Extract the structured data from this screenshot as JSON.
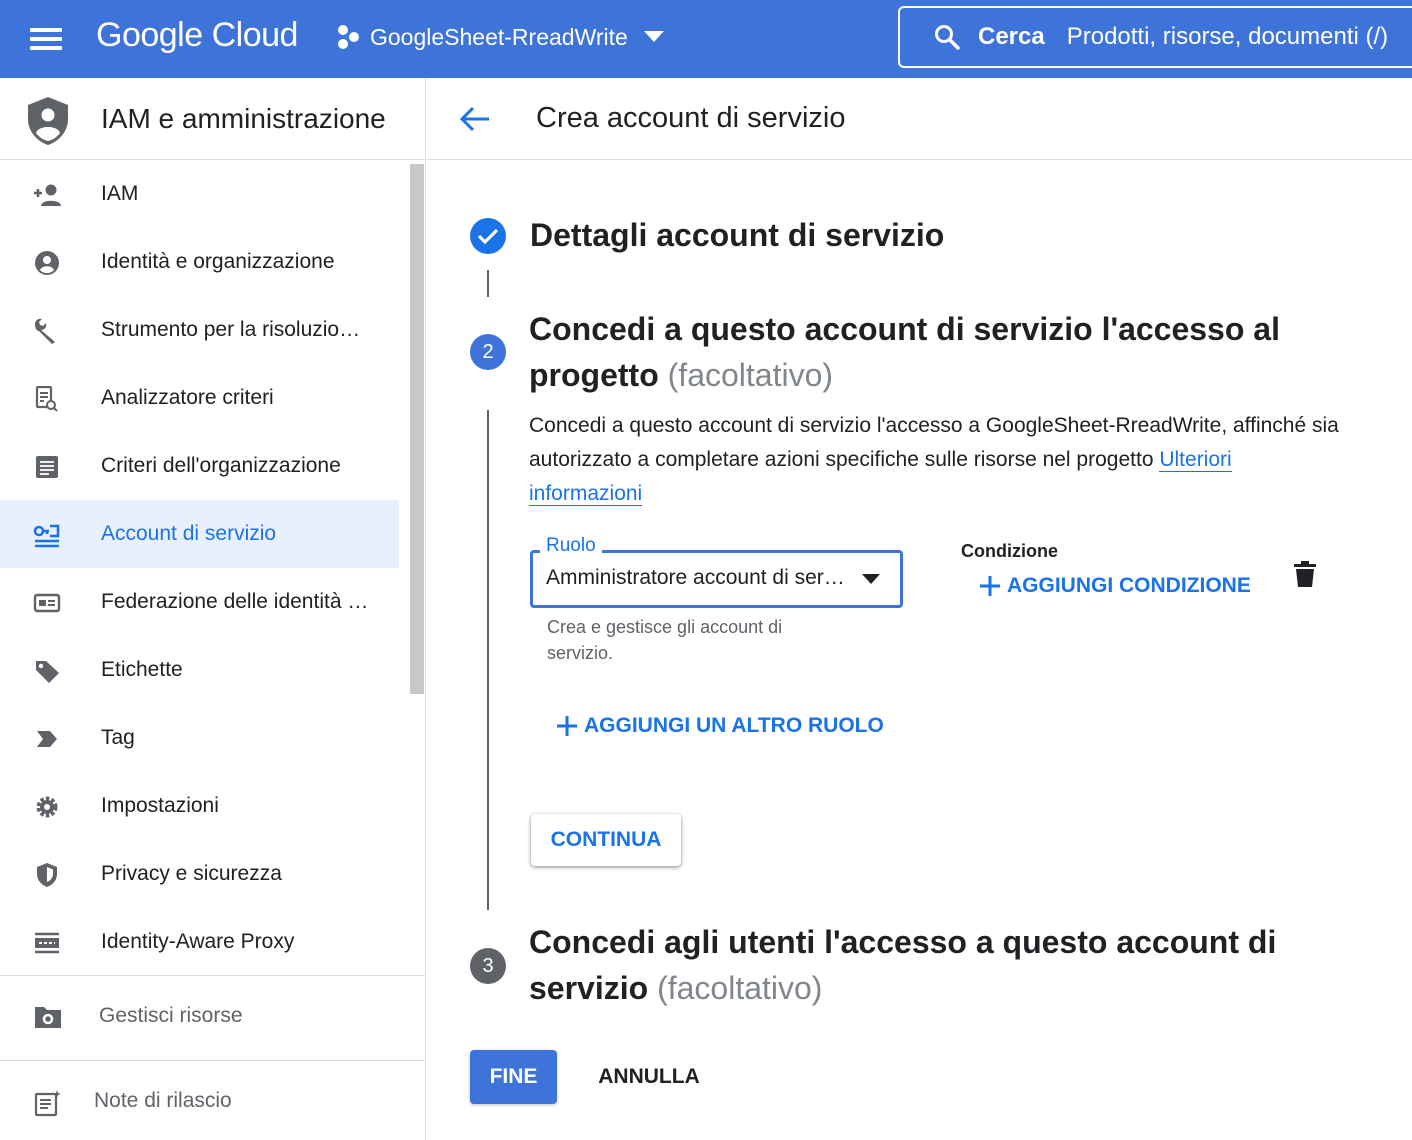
{
  "topbar": {
    "brand": "Google Cloud",
    "project": "GoogleSheet-RreadWrite",
    "search_label": "Cerca",
    "search_placeholder": "Prodotti, risorse, documenti (/)"
  },
  "sidebar": {
    "title": "IAM e amministrazione",
    "items": [
      {
        "label": "IAM",
        "icon": "person-add-icon"
      },
      {
        "label": "Identità e organizzazione",
        "icon": "account-circle-icon"
      },
      {
        "label": "Strumento per la risoluzio…",
        "icon": "wrench-icon"
      },
      {
        "label": "Analizzatore criteri",
        "icon": "policy-analyzer-icon"
      },
      {
        "label": "Criteri dell'organizzazione",
        "icon": "document-list-icon"
      },
      {
        "label": "Account di servizio",
        "icon": "service-account-icon",
        "active": true
      },
      {
        "label": "Federazione delle identità …",
        "icon": "id-card-icon"
      },
      {
        "label": "Etichette",
        "icon": "label-tag-icon"
      },
      {
        "label": "Tag",
        "icon": "tag-arrow-icon"
      },
      {
        "label": "Impostazioni",
        "icon": "gear-icon"
      },
      {
        "label": "Privacy e sicurezza",
        "icon": "shield-icon"
      },
      {
        "label": "Identity-Aware Proxy",
        "icon": "proxy-icon"
      }
    ],
    "manage_resources": "Gestisci risorse",
    "release_notes": "Note di rilascio"
  },
  "main": {
    "page_title": "Crea account di servizio",
    "step1": {
      "title": "Dettagli account di servizio"
    },
    "step2": {
      "number": "2",
      "title_line1": "Concedi a questo account di servizio l'accesso al",
      "title_line2": "progetto",
      "optional": "(facoltativo)",
      "description": "Concedi a questo account di servizio l'accesso a GoogleSheet-RreadWrite, affinché sia autorizzato a completare azioni specifiche sulle risorse nel progetto",
      "more_info_link": "Ulteriori informazioni",
      "role_label": "Ruolo",
      "role_value": "Amministratore account di servizio",
      "role_help": "Crea e gestisce gli account di servizio.",
      "condition_label": "Condizione",
      "add_condition": "AGGIUNGI CONDIZIONE",
      "add_role": "AGGIUNGI UN ALTRO RUOLO",
      "continue": "CONTINUA"
    },
    "step3": {
      "number": "3",
      "title_line1": "Concedi agli utenti l'accesso a questo account di",
      "title_line2": "servizio",
      "optional": "(facoltativo)"
    },
    "done": "FINE",
    "cancel": "ANNULLA"
  },
  "colors": {
    "topbar": "#3e74da",
    "accent": "#1a73e8",
    "active_bg": "#e8f0fe",
    "step_pending": "#5f6368"
  }
}
